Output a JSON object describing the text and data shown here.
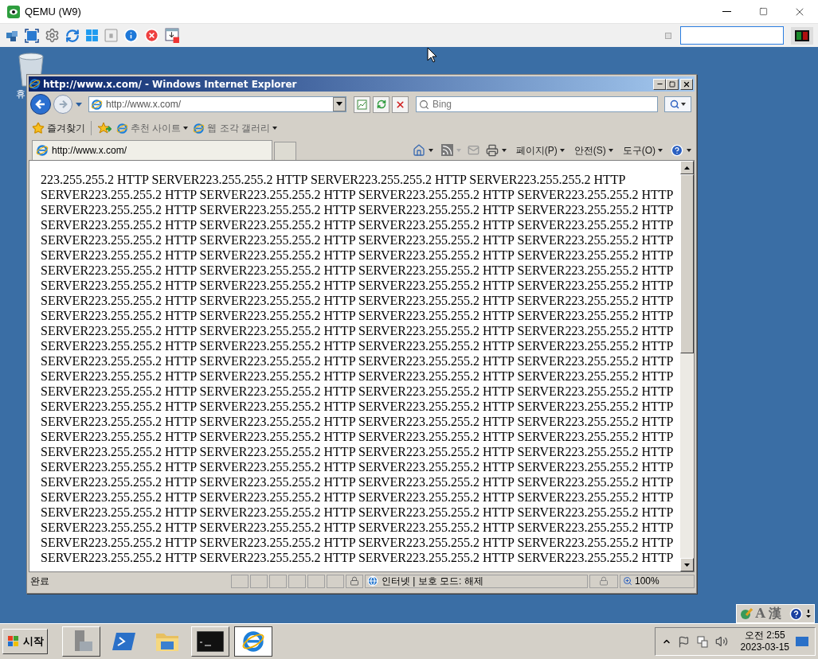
{
  "qemu": {
    "title": "QEMU (W9)"
  },
  "desktop": {
    "icons": [
      {
        "label": "휴"
      }
    ]
  },
  "ie": {
    "title": "http://www.x.com/ - Windows Internet Explorer",
    "address": "http://www.x.com/",
    "search_placeholder": "Bing",
    "favorites": "즐겨찾기",
    "links": [
      "추천 사이트",
      "웹 조각 갤러리"
    ],
    "tab": "http://www.x.com/",
    "commands": [
      "페이지(P)",
      "안전(S)",
      "도구(O)"
    ],
    "content_lines": [
      "223.255.255.2 HTTP SERVER223.255.255.2 HTTP SERVER223.255.255.2 HTTP SERVER223.255.255.2 HTTP",
      "SERVER223.255.255.2 HTTP SERVER223.255.255.2 HTTP SERVER223.255.255.2 HTTP SERVER223.255.255.2 HTTP",
      "SERVER223.255.255.2 HTTP SERVER223.255.255.2 HTTP SERVER223.255.255.2 HTTP SERVER223.255.255.2 HTTP",
      "SERVER223.255.255.2 HTTP SERVER223.255.255.2 HTTP SERVER223.255.255.2 HTTP SERVER223.255.255.2 HTTP",
      "SERVER223.255.255.2 HTTP SERVER223.255.255.2 HTTP SERVER223.255.255.2 HTTP SERVER223.255.255.2 HTTP",
      "SERVER223.255.255.2 HTTP SERVER223.255.255.2 HTTP SERVER223.255.255.2 HTTP SERVER223.255.255.2 HTTP",
      "SERVER223.255.255.2 HTTP SERVER223.255.255.2 HTTP SERVER223.255.255.2 HTTP SERVER223.255.255.2 HTTP",
      "SERVER223.255.255.2 HTTP SERVER223.255.255.2 HTTP SERVER223.255.255.2 HTTP SERVER223.255.255.2 HTTP",
      "SERVER223.255.255.2 HTTP SERVER223.255.255.2 HTTP SERVER223.255.255.2 HTTP SERVER223.255.255.2 HTTP",
      "SERVER223.255.255.2 HTTP SERVER223.255.255.2 HTTP SERVER223.255.255.2 HTTP SERVER223.255.255.2 HTTP",
      "SERVER223.255.255.2 HTTP SERVER223.255.255.2 HTTP SERVER223.255.255.2 HTTP SERVER223.255.255.2 HTTP",
      "SERVER223.255.255.2 HTTP SERVER223.255.255.2 HTTP SERVER223.255.255.2 HTTP SERVER223.255.255.2 HTTP",
      "SERVER223.255.255.2 HTTP SERVER223.255.255.2 HTTP SERVER223.255.255.2 HTTP SERVER223.255.255.2 HTTP",
      "SERVER223.255.255.2 HTTP SERVER223.255.255.2 HTTP SERVER223.255.255.2 HTTP SERVER223.255.255.2 HTTP",
      "SERVER223.255.255.2 HTTP SERVER223.255.255.2 HTTP SERVER223.255.255.2 HTTP SERVER223.255.255.2 HTTP",
      "SERVER223.255.255.2 HTTP SERVER223.255.255.2 HTTP SERVER223.255.255.2 HTTP SERVER223.255.255.2 HTTP",
      "SERVER223.255.255.2 HTTP SERVER223.255.255.2 HTTP SERVER223.255.255.2 HTTP SERVER223.255.255.2 HTTP",
      "SERVER223.255.255.2 HTTP SERVER223.255.255.2 HTTP SERVER223.255.255.2 HTTP SERVER223.255.255.2 HTTP",
      "SERVER223.255.255.2 HTTP SERVER223.255.255.2 HTTP SERVER223.255.255.2 HTTP SERVER223.255.255.2 HTTP",
      "SERVER223.255.255.2 HTTP SERVER223.255.255.2 HTTP SERVER223.255.255.2 HTTP SERVER223.255.255.2 HTTP",
      "SERVER223.255.255.2 HTTP SERVER223.255.255.2 HTTP SERVER223.255.255.2 HTTP SERVER223.255.255.2 HTTP",
      "SERVER223.255.255.2 HTTP SERVER223.255.255.2 HTTP SERVER223.255.255.2 HTTP SERVER223.255.255.2 HTTP",
      "SERVER223.255.255.2 HTTP SERVER223.255.255.2 HTTP SERVER223.255.255.2 HTTP SERVER223.255.255.2 HTTP",
      "SERVER223.255.255.2 HTTP SERVER223.255.255.2 HTTP SERVER223.255.255.2 HTTP SERVER223.255.255.2 HTTP",
      "SERVER223.255.255.2 HTTP SERVER223.255.255.2 HTTP SERVER223.255.255.2 HTTP SERVER223.255.255.2 HTTP",
      "SERVER223.255.255.2 HTTP SERVER223.255.255.2 HTTP SERVER223.255.255.2 HTTP SERVER223.255.255.2 HTTP"
    ],
    "status": {
      "text": "완료",
      "zone": "인터넷 | 보호 모드: 해제",
      "zoom": "100%"
    }
  },
  "taskbar": {
    "start": "시작",
    "lang_bar": [
      "A",
      "漢"
    ],
    "time": "오전 2:55",
    "date": "2023-03-15"
  }
}
